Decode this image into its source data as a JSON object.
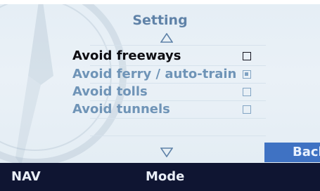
{
  "header": {
    "title": "Setting"
  },
  "options": [
    {
      "label": "Avoid freeways",
      "checked": false,
      "active": true
    },
    {
      "label": "Avoid ferry / auto-train",
      "checked": true,
      "active": false
    },
    {
      "label": "Avoid tolls",
      "checked": false,
      "active": false
    },
    {
      "label": "Avoid tunnels",
      "checked": false,
      "active": false
    }
  ],
  "back_label": "Back",
  "bottom_bar": {
    "nav_label": "NAV",
    "mode_label": "Mode"
  },
  "icons": {
    "scroll_up": "triangle-up-outline",
    "scroll_down": "triangle-down-outline",
    "background": "compass"
  },
  "colors": {
    "title": "#5f82a8",
    "active_text": "#0d0d12",
    "inactive_text": "#6f94b7",
    "back_button": "#3f72c3",
    "bottom_bar": "#0f1532"
  }
}
